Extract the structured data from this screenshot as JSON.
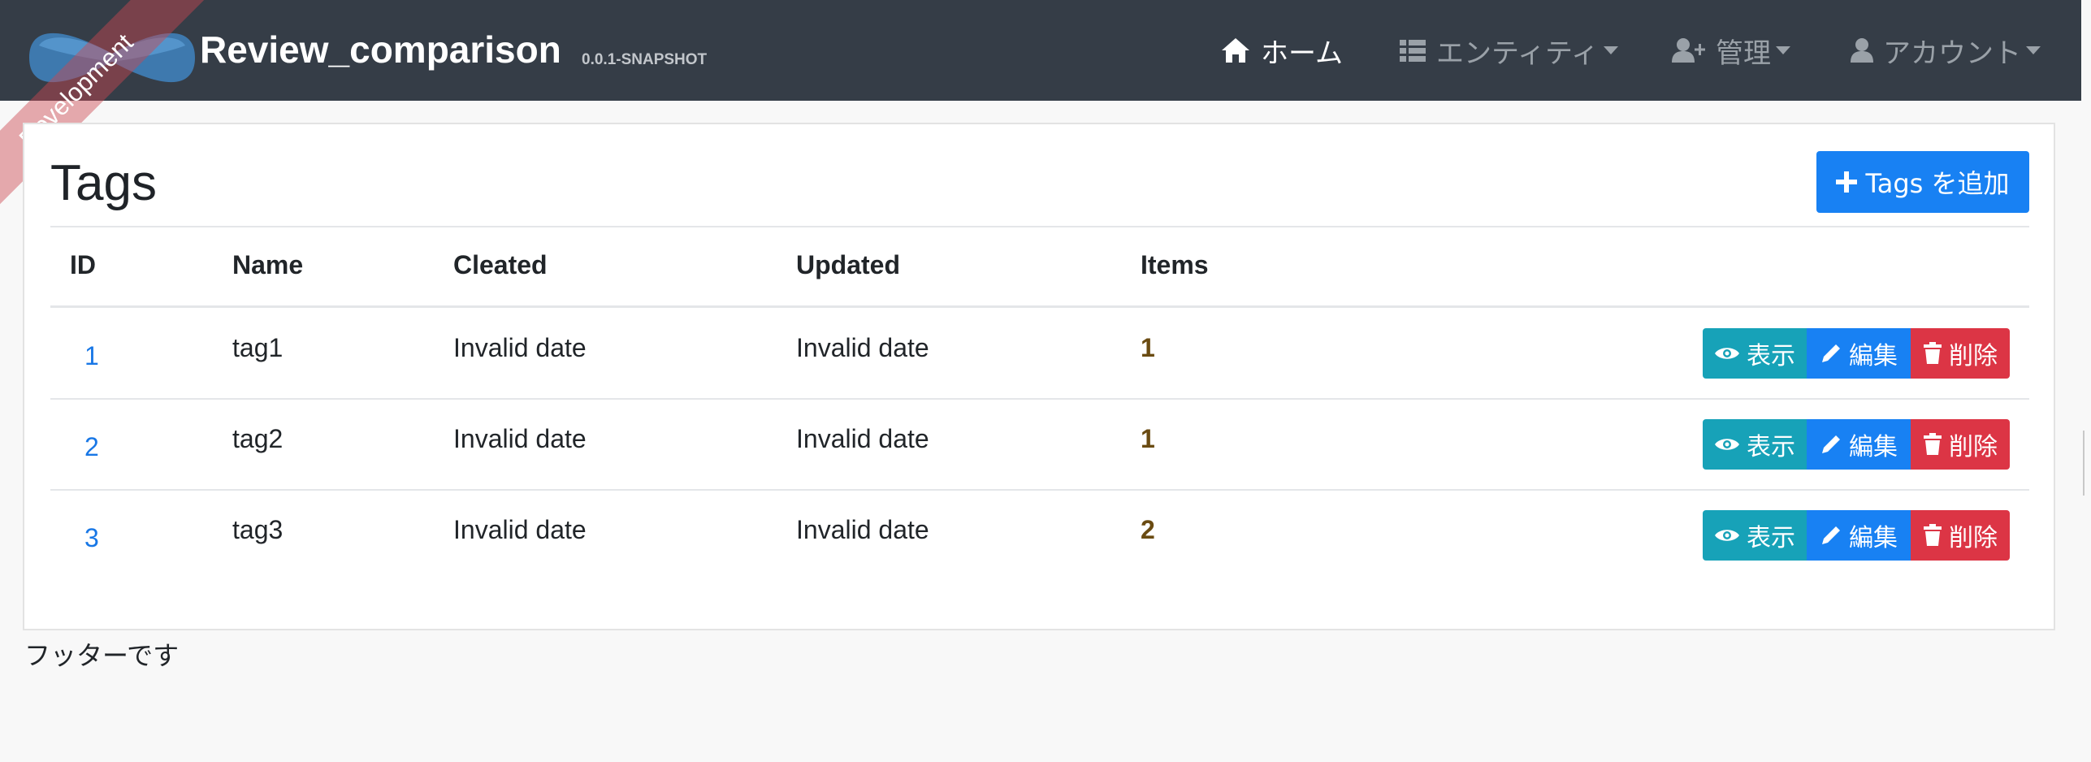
{
  "brand": {
    "title": "Review_comparison",
    "version": "0.0.1-SNAPSHOT",
    "ribbon": "Development"
  },
  "nav": [
    {
      "label": "ホーム",
      "icon": "home-icon"
    },
    {
      "label": "エンティティ",
      "icon": "th-list-icon"
    },
    {
      "label": "管理",
      "icon": "user-plus-icon"
    },
    {
      "label": "アカウント",
      "icon": "user-icon"
    }
  ],
  "page": {
    "title": "Tags",
    "add_button": "Tags を追加"
  },
  "table": {
    "headers": [
      "ID",
      "Name",
      "Cleated",
      "Updated",
      "Items"
    ],
    "rows": [
      {
        "id": "1",
        "name": "tag1",
        "created": "Invalid date",
        "updated": "Invalid date",
        "items": "1"
      },
      {
        "id": "2",
        "name": "tag2",
        "created": "Invalid date",
        "updated": "Invalid date",
        "items": "1"
      },
      {
        "id": "3",
        "name": "tag3",
        "created": "Invalid date",
        "updated": "Invalid date",
        "items": "2"
      }
    ],
    "actions": {
      "view": "表示",
      "edit": "編集",
      "delete": "削除"
    }
  },
  "footer": {
    "text": "フッターです"
  },
  "colors": {
    "navbar": "#353d47",
    "primary": "#1881f3",
    "info": "#17a2b8",
    "danger": "#dc3545"
  }
}
